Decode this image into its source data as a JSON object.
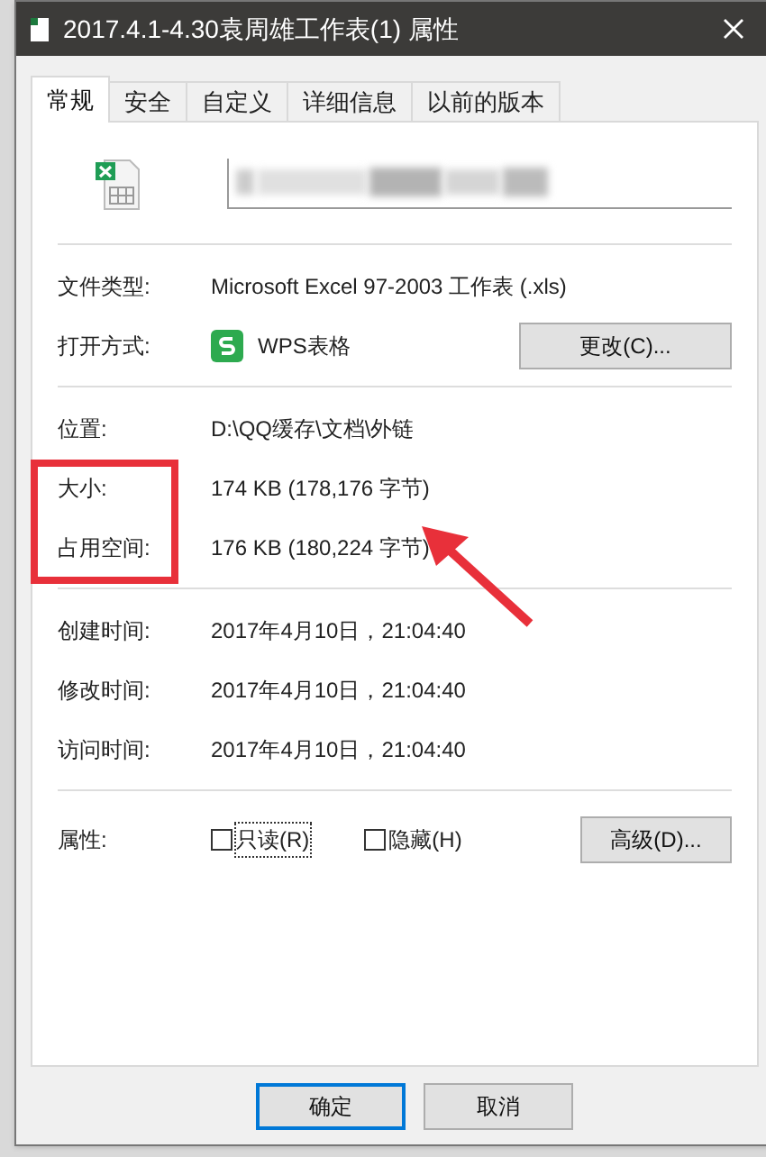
{
  "window": {
    "title": "2017.4.1-4.30袁周雄工作表(1) 属性"
  },
  "tabs": [
    {
      "label": "常规",
      "selected": true
    },
    {
      "label": "安全",
      "selected": false
    },
    {
      "label": "自定义",
      "selected": false
    },
    {
      "label": "详细信息",
      "selected": false
    },
    {
      "label": "以前的版本",
      "selected": false
    }
  ],
  "sections": [
    [
      {
        "label": "文件类型:",
        "value": "Microsoft Excel 97-2003 工作表 (.xls)"
      },
      {
        "label": "打开方式:",
        "value": "WPS表格",
        "button": "更改(C)..."
      }
    ],
    [
      {
        "label": "位置:",
        "value": "D:\\QQ缓存\\文档\\外链"
      },
      {
        "label": "大小:",
        "value": "174 KB (178,176 字节)",
        "highlighted": true
      },
      {
        "label": "占用空间:",
        "value": "176 KB (180,224 字节)",
        "highlighted": true
      }
    ],
    [
      {
        "label": "创建时间:",
        "value": "2017年4月10日，21:04:40"
      },
      {
        "label": "修改时间:",
        "value": "2017年4月10日，21:04:40"
      },
      {
        "label": "访问时间:",
        "value": "2017年4月10日，21:04:40"
      }
    ]
  ],
  "attributes": {
    "label": "属性:",
    "checkboxes": [
      {
        "label": "只读(R)",
        "checked": false,
        "focused": true
      },
      {
        "label": "隐藏(H)",
        "checked": false,
        "focused": false
      }
    ],
    "button": "高级(D)..."
  },
  "buttons": [
    {
      "label": "确定",
      "default": true
    },
    {
      "label": "取消",
      "default": false
    }
  ]
}
